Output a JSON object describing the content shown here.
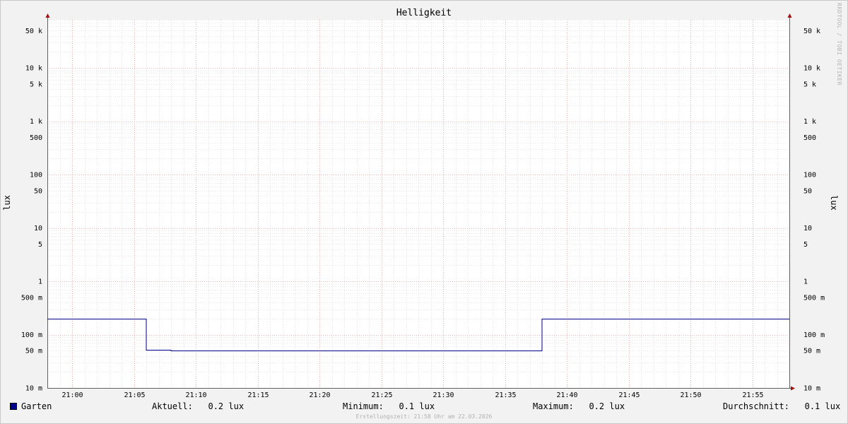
{
  "chart_data": {
    "type": "line",
    "title": "Helligkeit",
    "ylabel": "lux",
    "yscale": "log",
    "ylim": [
      0.01,
      80000
    ],
    "xlim": [
      "20:58",
      "21:58"
    ],
    "grid": true,
    "x_ticks": [
      "21:00",
      "21:05",
      "21:10",
      "21:15",
      "21:20",
      "21:25",
      "21:30",
      "21:35",
      "21:40",
      "21:45",
      "21:50",
      "21:55"
    ],
    "y_ticks": [
      {
        "value": 50000,
        "label": "50 k"
      },
      {
        "value": 10000,
        "label": "10 k"
      },
      {
        "value": 5000,
        "label": "5 k"
      },
      {
        "value": 1000,
        "label": "1 k"
      },
      {
        "value": 500,
        "label": "500"
      },
      {
        "value": 100,
        "label": "100"
      },
      {
        "value": 50,
        "label": "50"
      },
      {
        "value": 10,
        "label": "10"
      },
      {
        "value": 5,
        "label": "5"
      },
      {
        "value": 1,
        "label": "1"
      },
      {
        "value": 0.5,
        "label": "500 m"
      },
      {
        "value": 0.1,
        "label": "100 m"
      },
      {
        "value": 0.05,
        "label": "50 m"
      },
      {
        "value": 0.01,
        "label": "10 m"
      }
    ],
    "series": [
      {
        "name": "Garten",
        "color": "#00008b",
        "points": [
          [
            "20:58",
            0.2
          ],
          [
            "21:06",
            0.2
          ],
          [
            "21:06",
            0.052
          ],
          [
            "21:08",
            0.052
          ],
          [
            "21:08",
            0.05
          ],
          [
            "21:38",
            0.05
          ],
          [
            "21:38",
            0.2
          ],
          [
            "21:58",
            0.2
          ]
        ]
      }
    ]
  },
  "legend": {
    "series_name": "Garten",
    "current": "Aktuell:   0.2 lux",
    "minimum": "Minimum:   0.1 lux",
    "maximum": "Maximum:   0.2 lux",
    "average": "Durchschnitt:   0.1 lux"
  },
  "watermark": "RRDTOOL / TOBI OETIKER",
  "footer": "Erstellungszeit: 21:58 Uhr am 22.03.2026",
  "colors": {
    "series": "#00008b",
    "major_grid": "#e8a0a0",
    "minor_grid": "#d0d0d0",
    "axis": "#606060",
    "arrow": "#a01010",
    "background": "#f2f2f2",
    "plot_background": "#ffffff"
  }
}
